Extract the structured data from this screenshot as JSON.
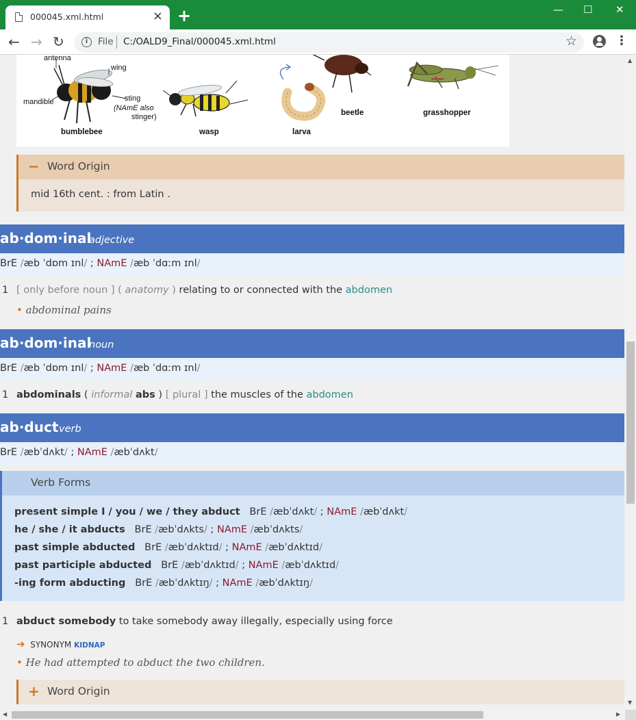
{
  "browser": {
    "tab_title": "000045.xml.html",
    "tab_close": "×",
    "new_tab": "+",
    "minimize": "—",
    "maximize": "☐",
    "close": "✕",
    "back": "←",
    "forward": "→",
    "reload": "↻",
    "info": "i",
    "scheme_label": "File",
    "url": "C:/OALD9_Final/000045.xml.html",
    "bookmark": "☆",
    "menu": "⋮"
  },
  "illustration": {
    "labels": {
      "antenna": "antenna",
      "wing": "wing",
      "mandible": "mandible",
      "sting": "sting",
      "sting_note1": "(NAmE also",
      "sting_note2": "stinger)"
    },
    "captions": [
      "bumblebee",
      "wasp",
      "larva",
      "beetle",
      "grasshopper"
    ]
  },
  "word_origin_1": {
    "toggle": "−",
    "title": "Word Origin",
    "text": "mid 16th cent. : from Latin ."
  },
  "entries": [
    {
      "headword": "ab·dom·inal",
      "pos": "adjective",
      "pron": {
        "bre_label": "BrE",
        "bre": "æb ˈdɒm ɪnl",
        "sep": ";",
        "name_label": "NAmE",
        "name": "æb ˈdɑːm ɪnl"
      },
      "sense": {
        "num": "1",
        "gram": "[ only before noun ]",
        "open": "(",
        "label": "anatomy",
        "close": ")",
        "def": "relating to or connected with the",
        "xref": "abdomen"
      },
      "example": "abdominal pains"
    },
    {
      "headword": "ab·dom·inal",
      "pos": "noun",
      "pron": {
        "bre_label": "BrE",
        "bre": "æb ˈdɒm ɪnl",
        "sep": ";",
        "name_label": "NAmE",
        "name": "æb ˈdɑːm ɪnl"
      },
      "sense": {
        "num": "1",
        "form": "abdominals",
        "open": "(",
        "label": "informal",
        "variant": "abs",
        "close": ")",
        "gram": "[ plural ]",
        "def": "the muscles of the",
        "xref": "abdomen"
      }
    },
    {
      "headword": "ab·duct",
      "pos": "verb",
      "pron": {
        "bre_label": "BrE",
        "bre": "æbˈdʌkt",
        "sep": ";",
        "name_label": "NAmE",
        "name": "æbˈdʌkt"
      },
      "verb_forms": {
        "title": "Verb Forms",
        "rows": [
          {
            "form": "present simple I / you / we / they abduct",
            "bre_label": "BrE",
            "bre": "æbˈdʌkt",
            "sep": ";",
            "name_label": "NAmE",
            "name": "æbˈdʌkt"
          },
          {
            "form": "he / she / it abducts",
            "bre_label": "BrE",
            "bre": "æbˈdʌkts",
            "sep": ";",
            "name_label": "NAmE",
            "name": "æbˈdʌkts"
          },
          {
            "form": "past simple abducted",
            "bre_label": "BrE",
            "bre": "æbˈdʌktɪd",
            "sep": ";",
            "name_label": "NAmE",
            "name": "æbˈdʌktɪd"
          },
          {
            "form": "past participle abducted",
            "bre_label": "BrE",
            "bre": "æbˈdʌktɪd",
            "sep": ";",
            "name_label": "NAmE",
            "name": "æbˈdʌktɪd"
          },
          {
            "form": "-ing form abducting",
            "bre_label": "BrE",
            "bre": "æbˈdʌktɪŋ",
            "sep": ";",
            "name_label": "NAmE",
            "name": "æbˈdʌktɪŋ"
          }
        ]
      },
      "sense": {
        "num": "1",
        "pattern": "abduct somebody",
        "def": "to take somebody away illegally, especially using force",
        "synonym_arrow": "➔",
        "synonym_label": "SYNONYM",
        "synonym": "KIDNAP"
      },
      "example": "He had attempted to abduct the two children."
    }
  ],
  "word_origin_2": {
    "toggle": "+",
    "title": "Word Origin"
  },
  "colors": {
    "browser_frame": "#1a8b3a",
    "entry_header": "#4a74bf",
    "origin_accent": "#c97a2a",
    "xref": "#2b8a8a",
    "name_label": "#8b1a2b"
  }
}
